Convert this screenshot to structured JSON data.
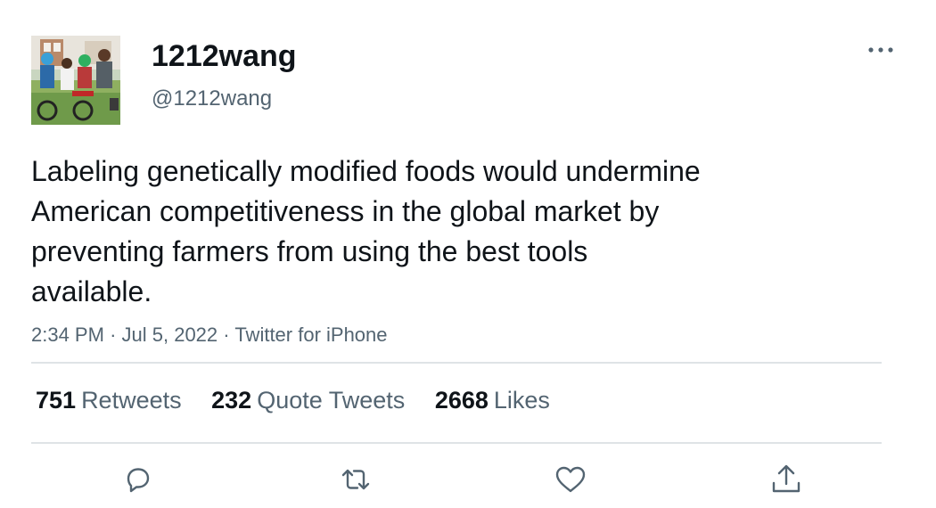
{
  "author": {
    "display_name": "1212wang",
    "handle": "@1212wang",
    "avatar_icon": "family-photo-avatar"
  },
  "tweet": {
    "text_lines": [
      "Labeling genetically modified foods would undermine",
      "American competitiveness in the global market by",
      "preventing farmers from using the best tools",
      "available."
    ],
    "time": "2:34 PM",
    "separator": "·",
    "date": "Jul 5, 2022",
    "source": "Twitter for iPhone"
  },
  "stats": {
    "retweets": {
      "count": "751",
      "label": "Retweets"
    },
    "quotes": {
      "count": "232",
      "label": "Quote Tweets"
    },
    "likes": {
      "count": "2668",
      "label": "Likes"
    }
  },
  "actions": [
    "reply-icon",
    "retweet-icon",
    "like-icon",
    "share-icon"
  ],
  "colors": {
    "text": "#0f1419",
    "secondary": "#536471",
    "divider": "#dfe3e6"
  }
}
